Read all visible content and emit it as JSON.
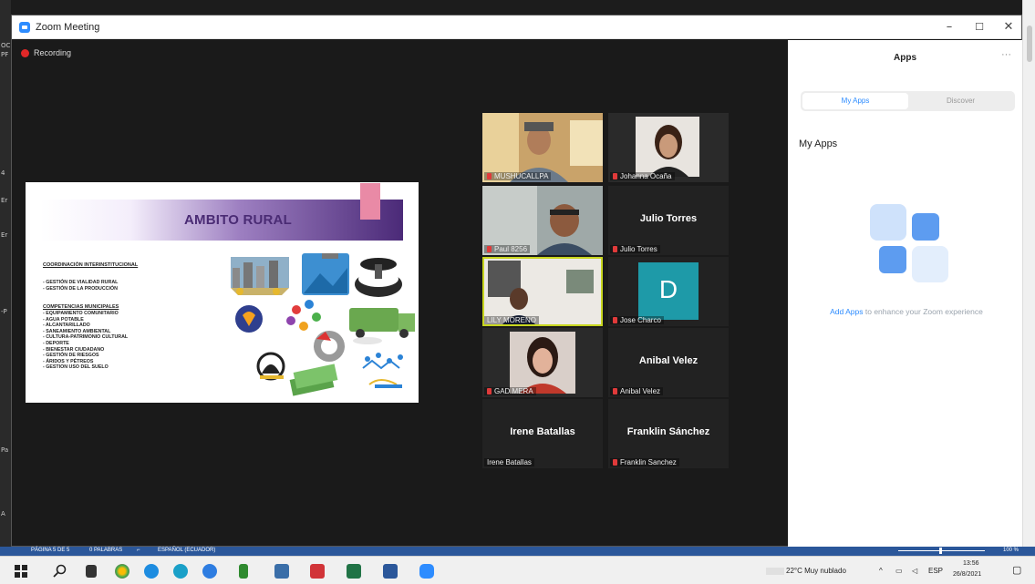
{
  "window": {
    "title": "Zoom Meeting",
    "minimize": "–",
    "maximize": "☐",
    "close": "✕"
  },
  "recording_label": "Recording",
  "slide": {
    "title": "AMBITO RURAL",
    "heading": "COORDINACIÓN INTERINSTITUCIONAL",
    "group1": [
      "- GESTIÓN DE VIALIDAD RURAL",
      "- GESTIÓN DE LA PRODUCCIÓN"
    ],
    "heading2": "COMPETENCIAS MUNICIPALES",
    "group2": [
      "- EQUIPAMIENTO COMUNITARIO",
      "- AGUA POTABLE",
      "- ALCANTARILLADO",
      "- SANEAMIENTO AMBIENTAL",
      "- CULTURA-PATRIMONIO CULTURAL",
      "- DEPORTE",
      "- BIENESTAR CIUDADANO",
      "- GESTIÓN DE RIESGOS",
      "- ÁRIDOS Y PÉTREOS",
      "- GESTION USO DEL SUELO"
    ]
  },
  "participants": [
    {
      "name": "",
      "caption": "MUSHUCALLPA",
      "video": true
    },
    {
      "name": "",
      "caption": "Johanna Ocaña",
      "video": true
    },
    {
      "name": "",
      "caption": "Paul 8256",
      "video": true
    },
    {
      "name": "Julio Torres",
      "caption": "Julio Torres",
      "video": false
    },
    {
      "name": "",
      "caption": "LILY MORENO",
      "video": true
    },
    {
      "name": "D",
      "caption": "Jose Charco",
      "video": false
    },
    {
      "name": "",
      "caption": "GAD MERA",
      "video": true
    },
    {
      "name": "Anibal Velez",
      "caption": "Anibal Velez",
      "video": false
    },
    {
      "name": "Irene Batallas",
      "caption": "Irene Batallas",
      "video": false
    },
    {
      "name": "Franklin Sánchez",
      "caption": "Franklin Sanchez",
      "video": false
    }
  ],
  "apps_panel": {
    "title": "Apps",
    "more": "···",
    "tab_my_apps": "My Apps",
    "tab_discover": "Discover",
    "section_title": "My Apps",
    "add_apps_link": "Add Apps",
    "add_apps_text": "to enhance your Zoom experience"
  },
  "word_statusbar": {
    "page": "PÁGINA 5 DE 5",
    "words": "0 PALABRAS",
    "language": "ESPAÑOL (ECUADOR)",
    "zoom": "100 %"
  },
  "taskbar": {
    "weather": "22°C Muy nublado",
    "lang": "ESP",
    "time": "13:56",
    "date": "26/8/2021"
  },
  "colors": {
    "zoom_blue": "#2d8cff",
    "recording_red": "#e02828",
    "word_blue": "#2b579a",
    "active_speaker": "#c8d61f",
    "avatar_teal": "#1e9aa8"
  }
}
